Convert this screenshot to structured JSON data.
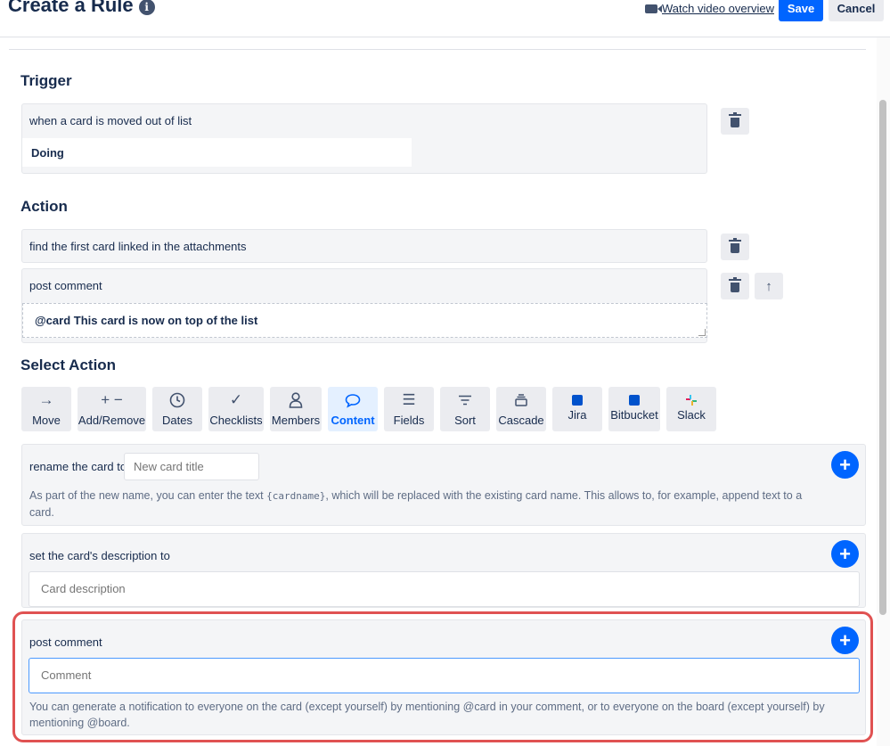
{
  "header": {
    "title": "Create a Rule",
    "video_link": "Watch video overview",
    "save_label": "Save",
    "cancel_label": "Cancel"
  },
  "trigger": {
    "heading": "Trigger",
    "text": "when a card is moved out of list",
    "list_value": "Doing"
  },
  "action": {
    "heading": "Action",
    "items": [
      {
        "text": "find the first card linked in the attachments"
      },
      {
        "text": "post comment",
        "value": "@card This card is now on top of the list"
      }
    ]
  },
  "select_action": {
    "heading": "Select Action",
    "tiles": [
      {
        "label": "Move",
        "icon": "arrow-right-icon"
      },
      {
        "label": "Add/Remove",
        "icon": "plus-minus-icon"
      },
      {
        "label": "Dates",
        "icon": "clock-icon"
      },
      {
        "label": "Checklists",
        "icon": "check-icon"
      },
      {
        "label": "Members",
        "icon": "person-icon"
      },
      {
        "label": "Content",
        "icon": "speech-bubble-icon",
        "active": true
      },
      {
        "label": "Fields",
        "icon": "lines-icon"
      },
      {
        "label": "Sort",
        "icon": "sort-icon"
      },
      {
        "label": "Cascade",
        "icon": "cascade-icon"
      },
      {
        "label": "Jira",
        "icon": "jira-icon"
      },
      {
        "label": "Bitbucket",
        "icon": "bitbucket-icon"
      },
      {
        "label": "Slack",
        "icon": "slack-icon"
      }
    ]
  },
  "options": {
    "rename": {
      "label": "rename the card to",
      "placeholder": "New card title",
      "help_before": "As part of the new name, you can enter the text ",
      "help_code": "{cardname}",
      "help_after": ", which will be replaced with the existing card name. This allows to, for example, append text to a",
      "help_line2": "card."
    },
    "description": {
      "label": "set the card's description to",
      "placeholder": "Card description"
    },
    "comment": {
      "label": "post comment",
      "placeholder": "Comment",
      "help_line1": "You can generate a notification to everyone on the card (except yourself) by mentioning @card in your comment, or to everyone on the board (except yourself) by",
      "help_line2": "mentioning @board."
    }
  },
  "colors": {
    "primary": "#0065ff",
    "highlight": "#e05252",
    "panel": "#f4f5f7"
  }
}
